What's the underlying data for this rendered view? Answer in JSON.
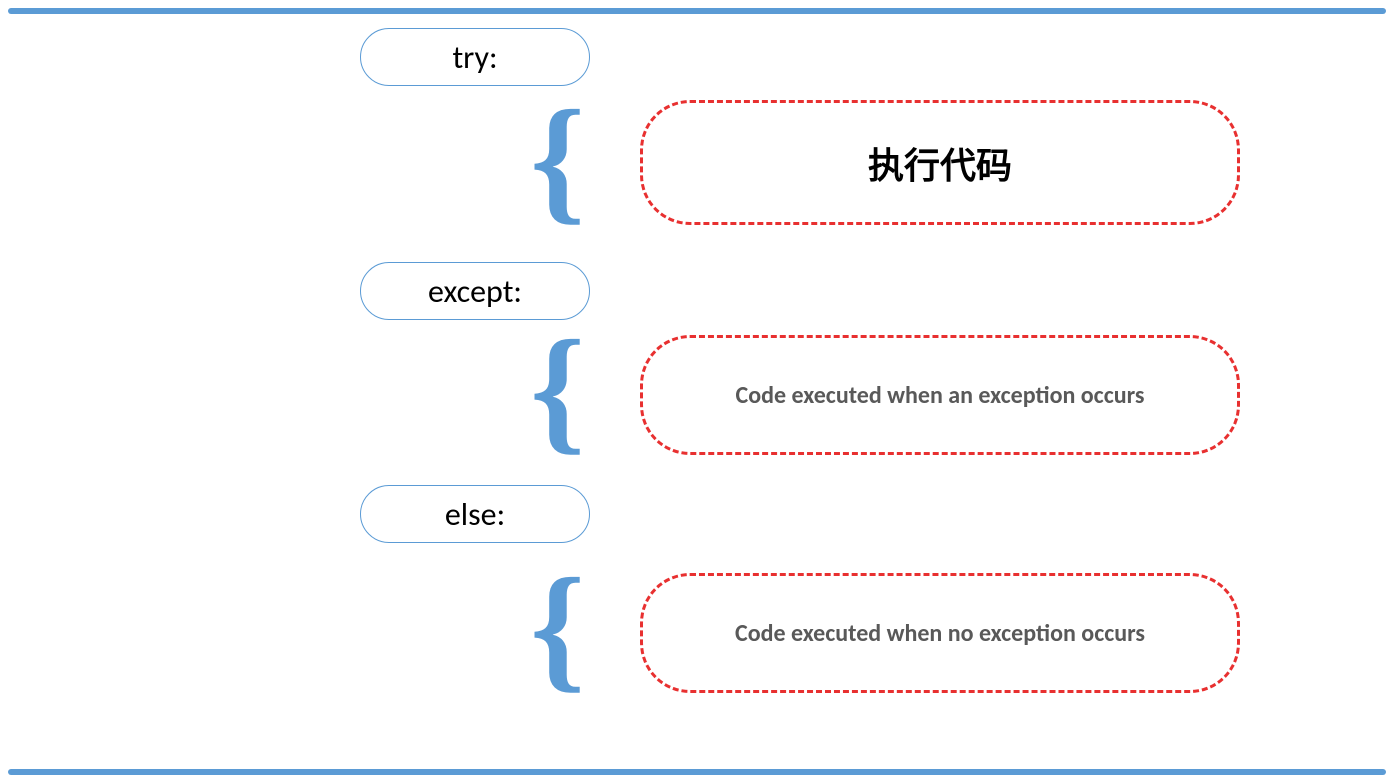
{
  "keywords": {
    "try": "try:",
    "except": "except:",
    "else": "else:"
  },
  "descriptions": {
    "try_desc": "执行代码",
    "except_desc": "Code executed when an exception occurs",
    "else_desc": "Code executed when no exception occurs"
  },
  "braces": {
    "brace": "{"
  }
}
